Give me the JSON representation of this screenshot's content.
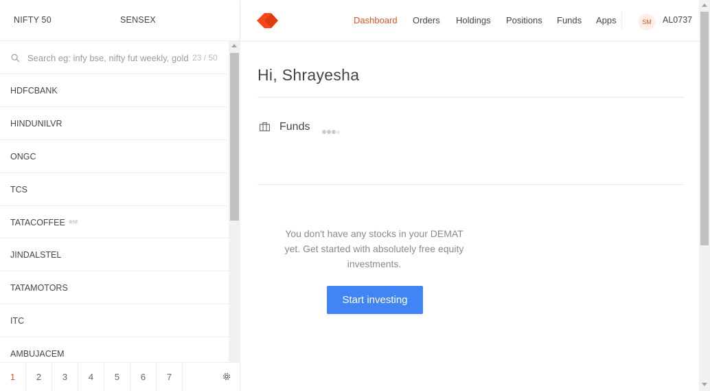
{
  "indices": [
    {
      "name": "NIFTY 50"
    },
    {
      "name": "SENSEX"
    }
  ],
  "search": {
    "placeholder": "Search eg: infy bse, nifty fut weekly, gold mcx",
    "count": "23 / 50"
  },
  "watchlist": [
    {
      "name": "HDFCBANK",
      "badge": ""
    },
    {
      "name": "HINDUNILVR",
      "badge": ""
    },
    {
      "name": "ONGC",
      "badge": ""
    },
    {
      "name": "TCS",
      "badge": ""
    },
    {
      "name": "TATACOFFEE",
      "badge": "BSE"
    },
    {
      "name": "JINDALSTEL",
      "badge": ""
    },
    {
      "name": "TATAMOTORS",
      "badge": ""
    },
    {
      "name": "ITC",
      "badge": ""
    },
    {
      "name": "AMBUJACEM",
      "badge": ""
    }
  ],
  "pages": [
    "1",
    "2",
    "3",
    "4",
    "5",
    "6",
    "7"
  ],
  "nav": [
    "Dashboard",
    "Orders",
    "Holdings",
    "Positions",
    "Funds",
    "Apps"
  ],
  "user": {
    "initials": "SM",
    "id": "AL0737"
  },
  "main": {
    "greeting": "Hi, Shrayesha",
    "funds_label": "Funds",
    "empty_message": "You don't have any stocks in your DEMAT yet. Get started with absolutely free equity investments.",
    "cta_label": "Start investing"
  },
  "colors": {
    "accent": "#e0531f",
    "cta": "#4184f3"
  },
  "icons": {
    "search": "search-icon",
    "settings": "gear-icon",
    "funds": "briefcase-icon",
    "logo": "kite-logo-icon"
  }
}
